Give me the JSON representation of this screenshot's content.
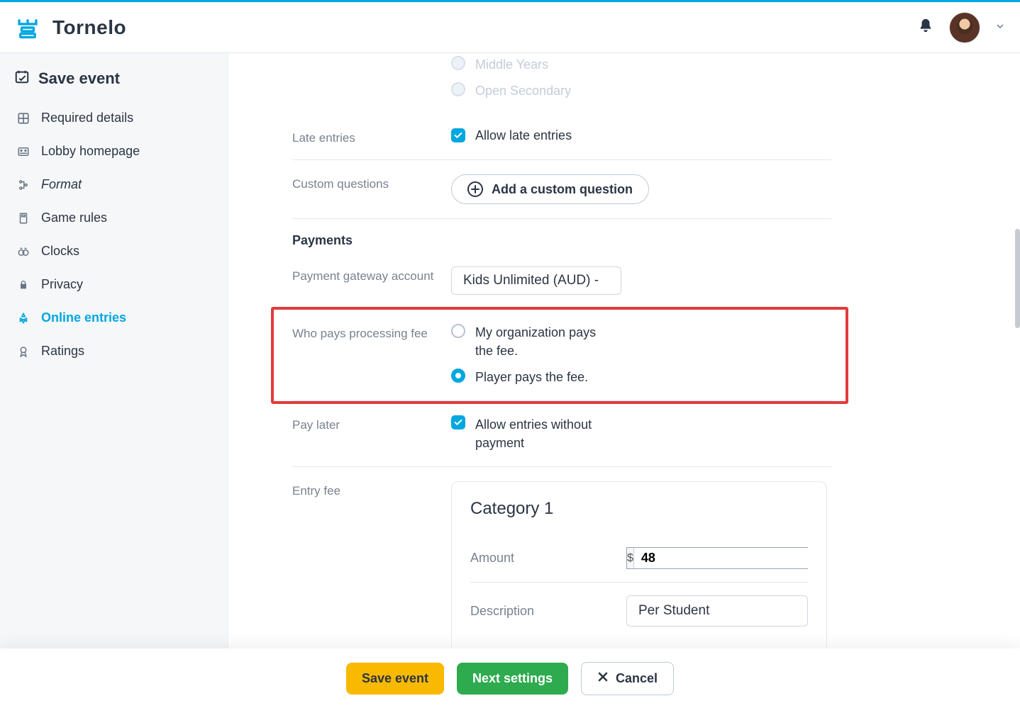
{
  "app": {
    "name": "Tornelo"
  },
  "sidebar": {
    "title": "Save event",
    "items": [
      {
        "key": "required-details",
        "label": "Required details",
        "italic": false
      },
      {
        "key": "lobby-homepage",
        "label": "Lobby homepage",
        "italic": false
      },
      {
        "key": "format",
        "label": "Format",
        "italic": true
      },
      {
        "key": "game-rules",
        "label": "Game rules",
        "italic": false
      },
      {
        "key": "clocks",
        "label": "Clocks",
        "italic": false
      },
      {
        "key": "privacy",
        "label": "Privacy",
        "italic": false
      },
      {
        "key": "online-entries",
        "label": "Online entries",
        "italic": false,
        "active": true
      },
      {
        "key": "ratings",
        "label": "Ratings",
        "italic": false
      }
    ]
  },
  "form": {
    "categories_remaining": [
      "Middle Years",
      "Open Secondary"
    ],
    "late_entries": {
      "label": "Late entries",
      "checkbox_label": "Allow late entries",
      "checked": true
    },
    "custom_questions": {
      "label": "Custom questions",
      "button": "Add a custom question"
    },
    "payments_heading": "Payments",
    "gateway": {
      "label": "Payment gateway account",
      "value": "Kids Unlimited (AUD) -"
    },
    "who_pays": {
      "label": "Who pays processing fee",
      "options": [
        {
          "label": "My organization pays the fee.",
          "selected": false
        },
        {
          "label": "Player pays the fee.",
          "selected": true
        }
      ]
    },
    "pay_later": {
      "label": "Pay later",
      "checkbox_label": "Allow entries without payment",
      "checked": true
    },
    "entry_fee": {
      "label": "Entry fee",
      "card_title": "Category 1",
      "amount_label": "Amount",
      "currency": "$",
      "amount": "48",
      "description_label": "Description",
      "description_value": "Per Student"
    }
  },
  "footer": {
    "save": "Save event",
    "next": "Next settings",
    "cancel": "Cancel"
  }
}
